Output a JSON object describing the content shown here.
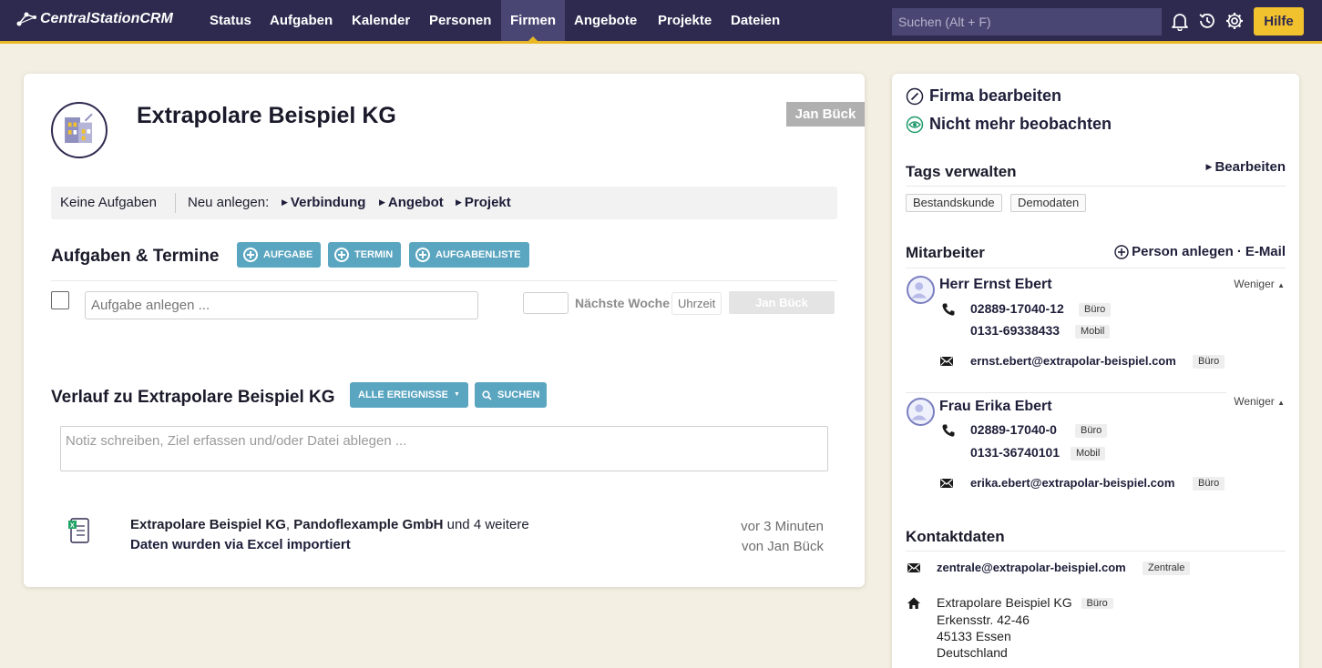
{
  "nav": {
    "logo": "CentralStationCRM",
    "items": [
      "Status",
      "Aufgaben",
      "Kalender",
      "Personen",
      "Firmen",
      "Angebote",
      "Projekte",
      "Dateien"
    ],
    "active": "Firmen",
    "search_placeholder": "Suchen (Alt + F)",
    "help_label": "Hilfe"
  },
  "company": {
    "name": "Extrapolare Beispiel KG",
    "owner": "Jan Bück"
  },
  "actionbar": {
    "no_tasks": "Keine Aufgaben",
    "new_label": "Neu anlegen:",
    "links": [
      "Verbindung",
      "Angebot",
      "Projekt"
    ]
  },
  "tasks": {
    "title": "Aufgaben & Termine",
    "buttons": [
      "AUFGABE",
      "TERMIN",
      "AUFGABENLISTE"
    ],
    "input_placeholder": "Aufgabe anlegen ...",
    "date_label": "Nächste Woche",
    "time_placeholder": "Uhrzeit",
    "assignee": "Jan Bück"
  },
  "history": {
    "title": "Verlauf zu Extrapolare Beispiel KG",
    "filter_label": "ALLE EREIGNISSE",
    "search_label": "SUCHEN",
    "note_placeholder": "Notiz schreiben, Ziel erfassen und/oder Datei ablegen ...",
    "entry": {
      "company1": "Extrapolare Beispiel KG",
      "company2": "Pandoflexample GmbH",
      "more": "und 4 weitere",
      "text": "Daten wurden via Excel importiert",
      "time": "vor 3 Minuten",
      "by": "von Jan Bück"
    }
  },
  "sidebar": {
    "edit_company": "Firma bearbeiten",
    "unwatch": "Nicht mehr beobachten",
    "tags_title": "Tags verwalten",
    "tags_edit": "Bearbeiten",
    "tags": [
      "Bestandskunde",
      "Demodaten"
    ],
    "staff_title": "Mitarbeiter",
    "staff_add": "Person anlegen",
    "staff_email": "E-Mail",
    "less_label": "Weniger",
    "persons": [
      {
        "name": "Herr Ernst Ebert",
        "phone1": "02889-17040-12",
        "phone1_type": "Büro",
        "phone2": "0131-69338433",
        "phone2_type": "Mobil",
        "email": "ernst.ebert@extrapolar-beispiel.com",
        "email_type": "Büro"
      },
      {
        "name": "Frau Erika Ebert",
        "phone1": "02889-17040-0",
        "phone1_type": "Büro",
        "phone2": "0131-36740101",
        "phone2_type": "Mobil",
        "email": "erika.ebert@extrapolar-beispiel.com",
        "email_type": "Büro"
      }
    ],
    "contact_title": "Kontaktdaten",
    "contact_email": "zentrale@extrapolar-beispiel.com",
    "contact_email_type": "Zentrale",
    "address": {
      "line1": "Extrapolare Beispiel KG",
      "type": "Büro",
      "street": "Erkensstr. 42-46",
      "city": "45133 Essen",
      "country": "Deutschland"
    }
  },
  "colors": {
    "nav_bg": "#2e2a4f",
    "accent_yellow": "#f2c12e",
    "button_teal": "#5aa5c0",
    "page_bg": "#f3efe2"
  }
}
